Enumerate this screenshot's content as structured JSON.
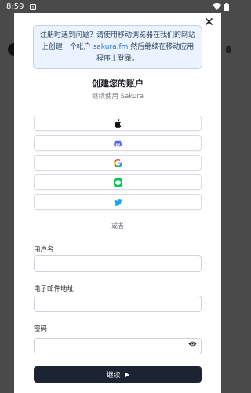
{
  "status_bar": {
    "time": "8:59"
  },
  "notice": {
    "before": "注册时遇到问题？请使用移动浏览器在我们的网站上创建一个帐户 ",
    "link": "sakura.fm",
    "after": " 然后继续在移动应用程序上登录。"
  },
  "title": "创建您的账户",
  "subtitle": "继续使用 Sakura",
  "oauth": [
    {
      "icon": "apple-icon"
    },
    {
      "icon": "discord-icon"
    },
    {
      "icon": "google-icon"
    },
    {
      "icon": "line-icon"
    },
    {
      "icon": "twitter-icon"
    }
  ],
  "divider": "或者",
  "form": {
    "username_label": "用户名",
    "email_label": "电子邮件地址",
    "password_label": "密码"
  },
  "continue_label": "继续",
  "colors": {
    "notice_bg": "#eaf3ff",
    "link": "#2f7ad9",
    "discord": "#5865F2",
    "line": "#06C755",
    "twitter": "#1DA1F2",
    "button_bg": "#1d2431"
  }
}
